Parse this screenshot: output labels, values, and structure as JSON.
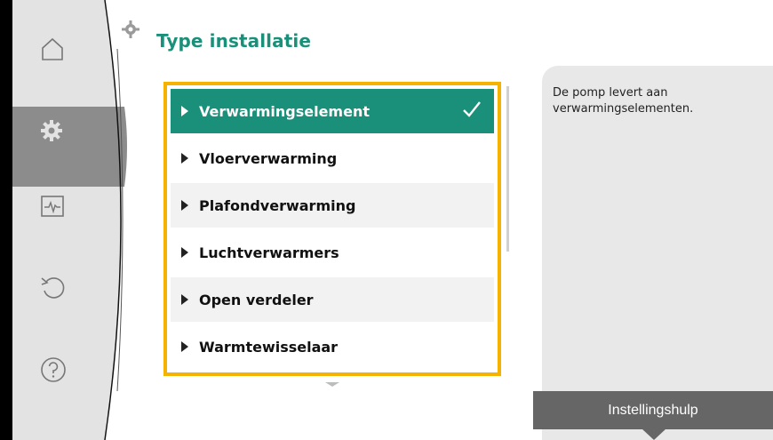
{
  "page": {
    "title": "Type installatie"
  },
  "sidebar": {
    "items": [
      {
        "icon": "home-icon",
        "active": false
      },
      {
        "icon": "gear-icon",
        "active": true
      },
      {
        "icon": "diagnostics-icon",
        "active": false
      },
      {
        "icon": "undo-icon",
        "active": false
      },
      {
        "icon": "help-icon",
        "active": false
      }
    ]
  },
  "list": {
    "items": [
      {
        "label": "Verwarmingselement",
        "selected": true
      },
      {
        "label": "Vloerverwarming",
        "selected": false
      },
      {
        "label": "Plafondverwarming",
        "selected": false
      },
      {
        "label": "Luchtverwarmers",
        "selected": false
      },
      {
        "label": "Open verdeler",
        "selected": false
      },
      {
        "label": "Warmtewisselaar",
        "selected": false
      }
    ]
  },
  "help": {
    "text": "De pomp levert aan verwarmingselementen.",
    "button_label": "Instellingshulp"
  },
  "colors": {
    "accent": "#1a8f7a",
    "frame": "#f5b300",
    "sidebar": "#e3e3e3",
    "sidebar_active": "#8c8c8c",
    "panel": "#e8e8e8",
    "button": "#666666"
  }
}
